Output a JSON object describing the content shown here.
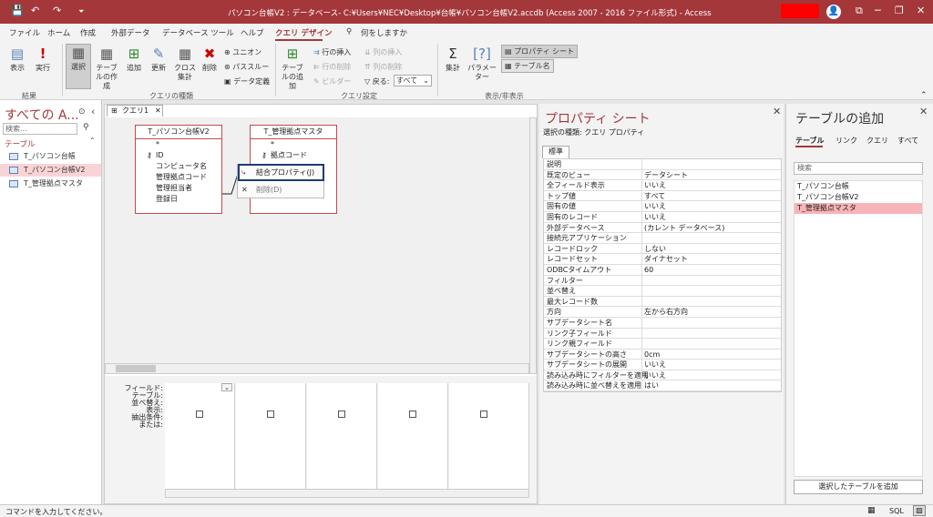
{
  "titlebar": {
    "title": "パソコン台帳V2 : データベース- C:¥Users¥NEC¥Desktop¥台帳¥パソコン台帳V2.accdb (Access 2007 - 2016 ファイル形式)  -  Access",
    "save_icon": "💾",
    "undo_icon": "↶",
    "redo_icon": "↷",
    "customize_icon": "⏷",
    "avatar_icon": "👤",
    "ribbon_opts_icon": "⧉",
    "minimize_icon": "─",
    "maximize_icon": "❐",
    "close_icon": "✕"
  },
  "menu": [
    "ファイル",
    "ホーム",
    "作成",
    "外部データ",
    "データベース ツール",
    "ヘルプ",
    "クエリ デザイン"
  ],
  "menu_search": "何をしますか",
  "ribbon": {
    "view": "表示",
    "run": "実行",
    "select": "選択",
    "maketable": "テーブルの作成",
    "append": "追加",
    "update": "更新",
    "crosstab": "クロス集計",
    "delete": "削除",
    "union": "ユニオン",
    "passthrough": "パススルー",
    "datadef": "データ定義",
    "showtable": "テーブルの追加",
    "insertrows": "行の挿入",
    "deleterows": "行の削除",
    "builder": "ビルダー",
    "insertcols": "列の挿入",
    "deletecols": "列の削除",
    "returns_label": "戻る:",
    "returns_value": "すべて",
    "totals": "集計",
    "params": "パラメーター",
    "propsheet": "プロパティ シート",
    "tablenames": "テーブル名",
    "group_results": "結果",
    "group_type": "クエリの種類",
    "group_setup": "クエリ設定",
    "group_showhide": "表示/非表示"
  },
  "nav": {
    "title": "すべての A...",
    "search_placeholder": "検索...",
    "section": "テーブル",
    "items": [
      "T_パソコン台帳",
      "T_パソコン台帳V2",
      "T_管理拠点マスタ"
    ]
  },
  "query": {
    "tab": "クエリ1",
    "table1": {
      "name": "T_パソコン台帳V2",
      "fields": [
        "*",
        "ID",
        "コンピュータ名",
        "管理拠点コード",
        "管理担当者",
        "登録日"
      ]
    },
    "table2": {
      "name": "T_管理拠点マスタ",
      "fields": [
        "*",
        "拠点コード"
      ]
    },
    "ctx": {
      "join_props": "結合プロパティ(J)",
      "delete": "削除(D)"
    },
    "grid_labels": [
      "フィールド:",
      "テーブル:",
      "並べ替え:",
      "表示:",
      "抽出条件:",
      "または:"
    ]
  },
  "props": {
    "title": "プロパティ シート",
    "type": "選択の種類: クエリ プロパティ",
    "tab": "標準",
    "rows": [
      [
        "説明",
        ""
      ],
      [
        "既定のビュー",
        "データシート"
      ],
      [
        "全フィールド表示",
        "いいえ"
      ],
      [
        "トップ値",
        "すべて"
      ],
      [
        "固有の値",
        "いいえ"
      ],
      [
        "固有のレコード",
        "いいえ"
      ],
      [
        "外部データベース",
        "(カレント データベース)"
      ],
      [
        "接続元アプリケーション",
        ""
      ],
      [
        "レコードロック",
        "しない"
      ],
      [
        "レコードセット",
        "ダイナセット"
      ],
      [
        "ODBCタイムアウト",
        "60"
      ],
      [
        "フィルター",
        ""
      ],
      [
        "並べ替え",
        ""
      ],
      [
        "最大レコード数",
        ""
      ],
      [
        "方向",
        "左から右方向"
      ],
      [
        "サブデータシート名",
        ""
      ],
      [
        "リンク子フィールド",
        ""
      ],
      [
        "リンク親フィールド",
        ""
      ],
      [
        "サブデータシートの高さ",
        "0cm"
      ],
      [
        "サブデータシートの展開",
        "いいえ"
      ],
      [
        "読み込み時にフィルターを適用",
        "いいえ"
      ],
      [
        "読み込み時に並べ替えを適用",
        "はい"
      ]
    ]
  },
  "addtable": {
    "title": "テーブルの追加",
    "tabs": [
      "テーブル",
      "リンク",
      "クエリ",
      "すべて"
    ],
    "search_placeholder": "検索",
    "items": [
      "T_パソコン台帳",
      "T_パソコン台帳V2",
      "T_管理拠点マスタ"
    ],
    "button": "選択したテーブルを追加"
  },
  "status": {
    "text": "コマンドを入力してください。",
    "sql": "SQL"
  },
  "colors": {
    "accent": "#a4373a",
    "selection": "#f8b4b8",
    "highlight_box": "#1f3c72"
  }
}
